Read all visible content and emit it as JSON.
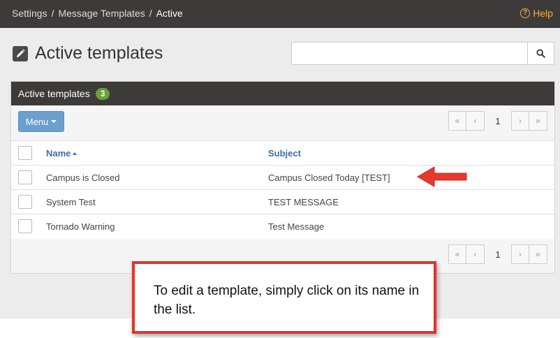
{
  "breadcrumb": {
    "items": [
      "Settings",
      "Message Templates",
      "Active"
    ],
    "separator": "/"
  },
  "help": {
    "label": "Help",
    "icon": "question-circle-icon"
  },
  "page": {
    "title": "Active templates",
    "icon": "edit-icon"
  },
  "search": {
    "placeholder": "",
    "value": "",
    "button_icon": "search-icon"
  },
  "panel": {
    "title": "Active templates",
    "count": "3",
    "menu_label": "Menu",
    "pager": {
      "first": "«",
      "prev": "‹",
      "page": "1",
      "next": "›",
      "last": "»"
    },
    "columns": {
      "name": "Name",
      "subject": "Subject"
    },
    "rows": [
      {
        "name": "Campus is Closed",
        "subject": "Campus Closed Today [TEST]"
      },
      {
        "name": "System Test",
        "subject": "TEST MESSAGE"
      },
      {
        "name": "Tornado Warning",
        "subject": "Test Message"
      }
    ]
  },
  "callout": {
    "text": "To edit a template, simply click on its name in the list."
  },
  "colors": {
    "topbar": "#3d3b39",
    "help": "#f0ad4e",
    "badge": "#6a9e3a",
    "menu_button": "#6a9fcf",
    "link": "#3a6ea5",
    "callout_border": "#e0352a",
    "arrow": "#e8392e"
  }
}
